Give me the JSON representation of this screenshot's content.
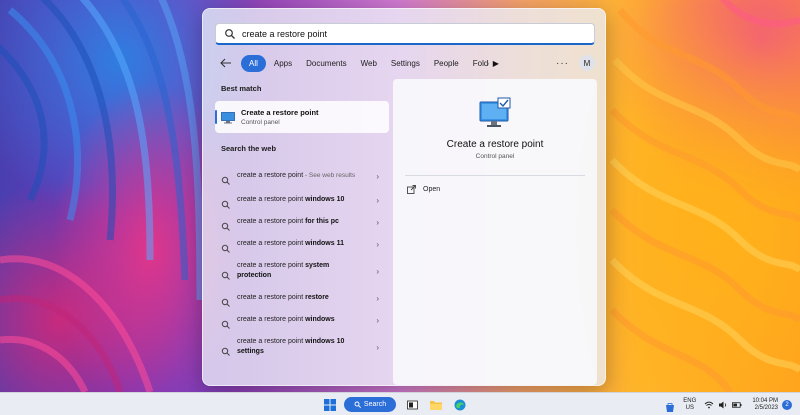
{
  "search": {
    "value": "create a restore point"
  },
  "filters": {
    "items": [
      "All",
      "Apps",
      "Documents",
      "Web",
      "Settings",
      "People",
      "Folde"
    ],
    "more_glyph": "▶",
    "overflow_glyph": "···",
    "avatar_initial": "M"
  },
  "best_match": {
    "heading": "Best match",
    "title": "Create a restore point",
    "subtitle": "Control panel"
  },
  "web": {
    "heading": "Search the web",
    "items": [
      {
        "query": "create a restore point",
        "suffix": "",
        "note": " - See web results"
      },
      {
        "query": "create a restore point ",
        "suffix": "windows 10",
        "note": ""
      },
      {
        "query": "create a restore point ",
        "suffix": "for this pc",
        "note": ""
      },
      {
        "query": "create a restore point ",
        "suffix": "windows 11",
        "note": ""
      },
      {
        "query": "create a restore point ",
        "suffix": "system protection",
        "note": ""
      },
      {
        "query": "create a restore point ",
        "suffix": "restore",
        "note": ""
      },
      {
        "query": "create a restore point ",
        "suffix": "windows",
        "note": ""
      },
      {
        "query": "create a restore point ",
        "suffix": "windows 10 settings",
        "note": ""
      }
    ],
    "chevron": "›"
  },
  "detail": {
    "title": "Create a restore point",
    "subtitle": "Control panel",
    "action_open": "Open"
  },
  "taskbar": {
    "search_label": "Search",
    "lang_top": "ENG",
    "lang_bottom": "US",
    "time": "10:04 PM",
    "date": "2/5/2023",
    "notification_count": "2"
  },
  "colors": {
    "accent": "#2c6ed8"
  }
}
